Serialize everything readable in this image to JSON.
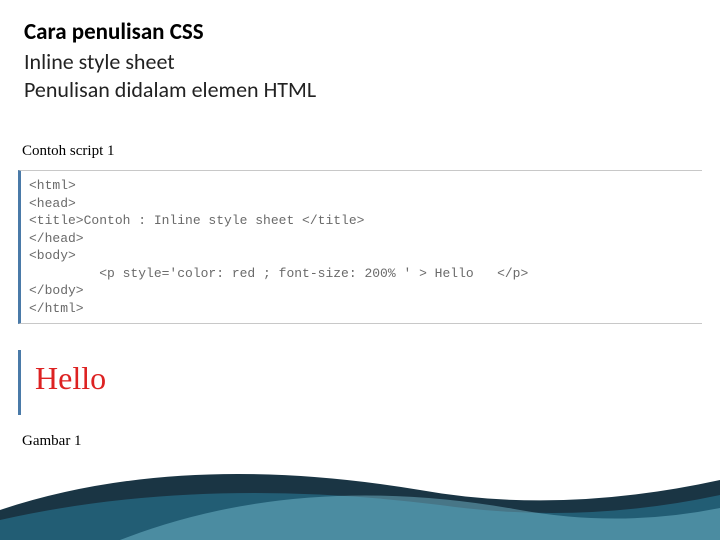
{
  "heading": {
    "title": "Cara penulisan CSS",
    "line1": "Inline style sheet",
    "line2": "Penulisan didalam elemen HTML"
  },
  "example": {
    "label": "Contoh script 1",
    "code_lines": [
      "<html>",
      "<head>",
      "<title>Contoh : Inline style sheet </title>",
      "</head>",
      "<body>",
      "         <p style='color: red ; font-size: 200% ' > Hello   </p>",
      "</body>",
      "</html>"
    ],
    "output_text": "Hello",
    "figure_label": "Gambar 1"
  }
}
